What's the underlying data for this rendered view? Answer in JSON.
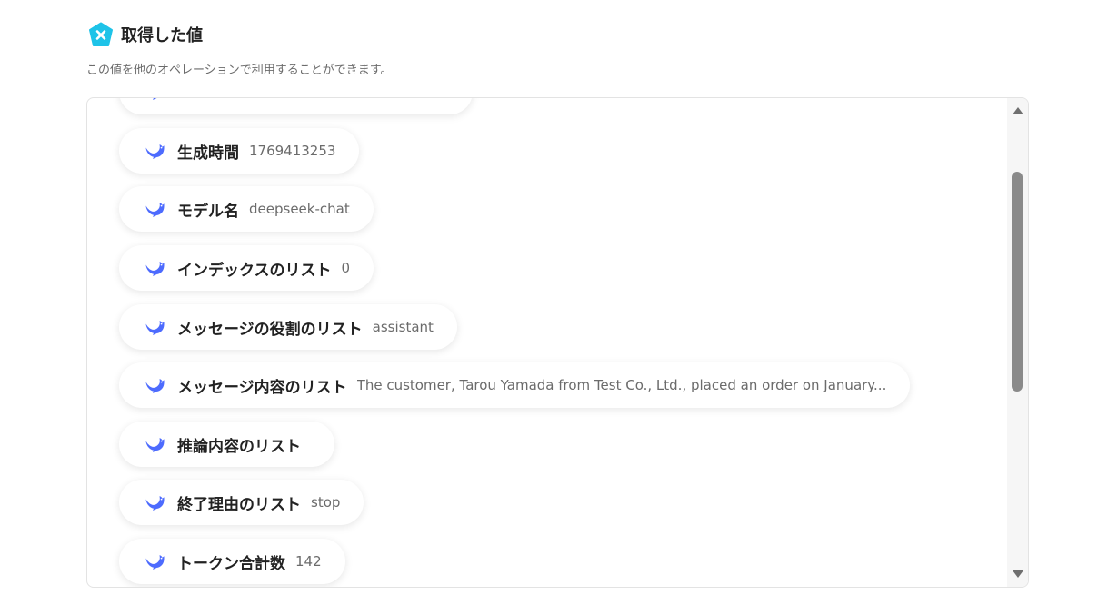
{
  "header": {
    "title": "取得した値",
    "subtitle": "この値を他のオペレーションで利用することができます。",
    "logo_color": "#1ec3e8"
  },
  "list": {
    "icon": "deepseek-whale-icon",
    "icon_color": "#4d6bfe",
    "items": [
      {
        "label": "",
        "value": ""
      },
      {
        "label": "生成時間",
        "value": "1769413253"
      },
      {
        "label": "モデル名",
        "value": "deepseek-chat"
      },
      {
        "label": "インデックスのリスト",
        "value": "0"
      },
      {
        "label": "メッセージの役割のリスト",
        "value": "assistant"
      },
      {
        "label": "メッセージ内容のリスト",
        "value": "The customer, Tarou Yamada from Test Co., Ltd., placed an order on January..."
      },
      {
        "label": "推論内容のリスト",
        "value": ""
      },
      {
        "label": "終了理由のリスト",
        "value": "stop"
      },
      {
        "label": "トークン合計数",
        "value": "142"
      }
    ]
  },
  "scrollbar": {
    "position_fraction": 0.15
  }
}
